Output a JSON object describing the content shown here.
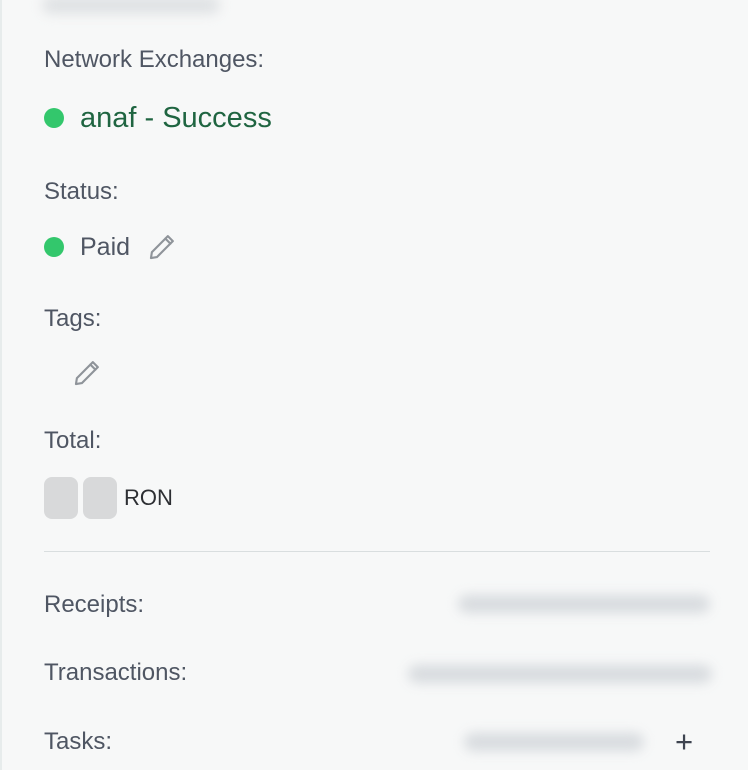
{
  "network_exchanges": {
    "label": "Network Exchanges:",
    "value": "anaf - Success",
    "status_color": "#33c76c"
  },
  "status": {
    "label": "Status:",
    "value": "Paid",
    "status_color": "#33c76c",
    "edit_icon": "pencil-icon"
  },
  "tags": {
    "label": "Tags:",
    "edit_icon": "pencil-icon"
  },
  "total": {
    "label": "Total:",
    "currency": "RON"
  },
  "summary": {
    "receipts_label": "Receipts:",
    "transactions_label": "Transactions:",
    "tasks_label": "Tasks:",
    "add_task_label": "+"
  }
}
